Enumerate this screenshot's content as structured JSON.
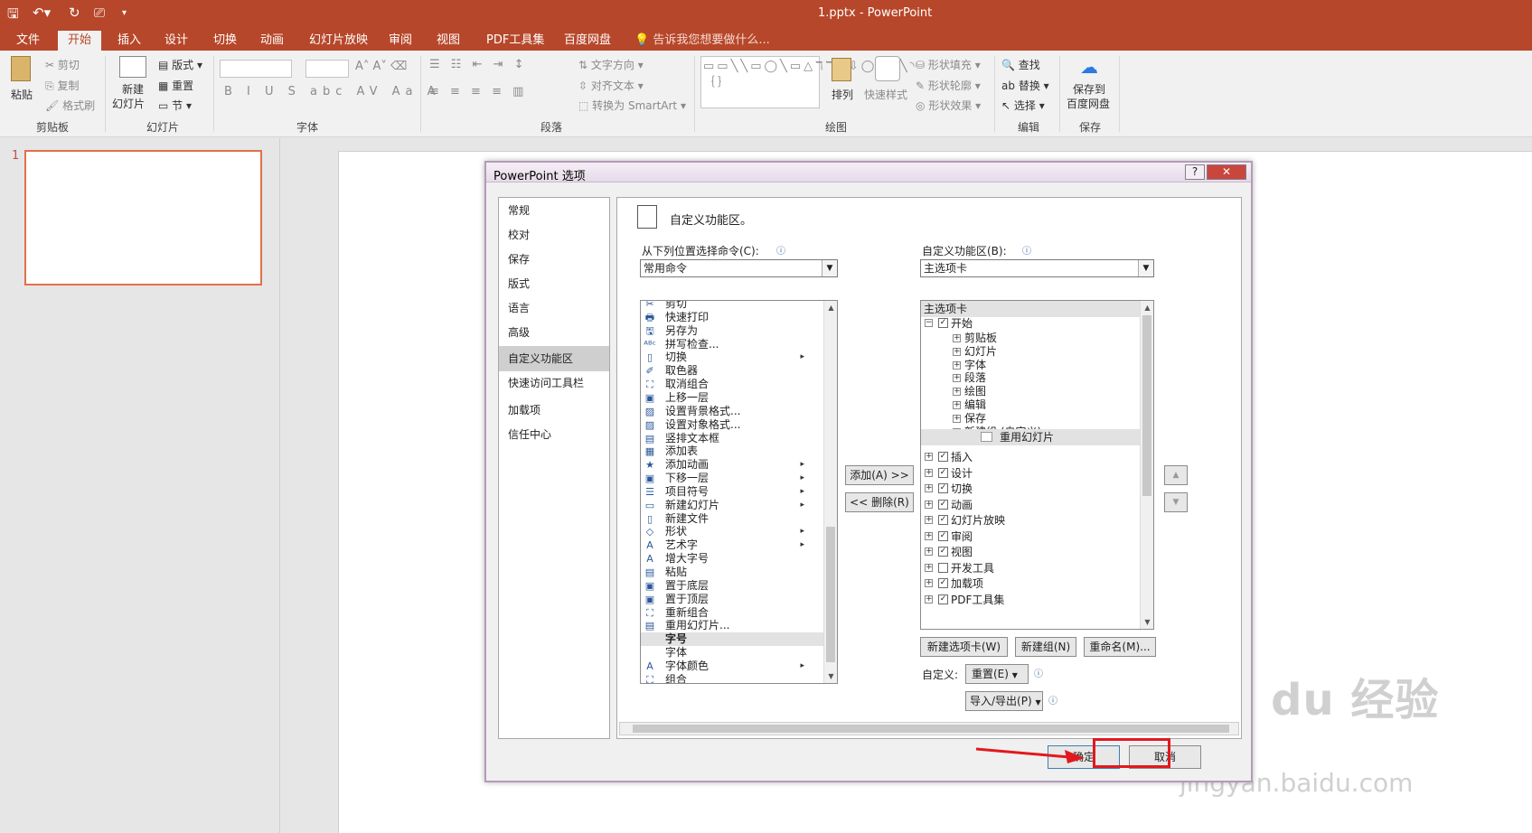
{
  "titlebar": {
    "title": "1.pptx - PowerPoint"
  },
  "tabs": [
    "文件",
    "开始",
    "插入",
    "设计",
    "切换",
    "动画",
    "幻灯片放映",
    "审阅",
    "视图",
    "PDF工具集",
    "百度网盘"
  ],
  "tell_me": "告诉我您想要做什么...",
  "ribbon": {
    "clipboard": {
      "paste": "粘贴",
      "cut": "剪切",
      "copy": "复制",
      "format_painter": "格式刷",
      "label": "剪贴板"
    },
    "slides": {
      "new_slide_1": "新建",
      "new_slide_2": "幻灯片",
      "layout": "版式",
      "reset": "重置",
      "section": "节",
      "label": "幻灯片"
    },
    "font": {
      "label": "字体"
    },
    "paragraph": {
      "text_direction": "文字方向",
      "align_text": "对齐文本",
      "smartart": "转换为 SmartArt",
      "label": "段落"
    },
    "drawing": {
      "arrange": "排列",
      "quick_styles": "快速样式",
      "shape_fill": "形状填充",
      "shape_outline": "形状轮廓",
      "shape_effects": "形状效果",
      "label": "绘图"
    },
    "editing": {
      "find": "查找",
      "replace": "替换",
      "select": "选择",
      "label": "编辑"
    },
    "save": {
      "save_1": "保存到",
      "save_2": "百度网盘",
      "label": "保存"
    }
  },
  "thumbnail": {
    "number": "1"
  },
  "dialog": {
    "title": "PowerPoint 选项",
    "help": "?",
    "close": "✕",
    "categories": [
      "常规",
      "校对",
      "保存",
      "版式",
      "语言",
      "高级",
      "自定义功能区",
      "快速访问工具栏",
      "加载项",
      "信任中心"
    ],
    "heading": "自定义功能区。",
    "left_label": "从下列位置选择命令(C):",
    "left_combo": "常用命令",
    "right_label": "自定义功能区(B):",
    "right_combo": "主选项卡",
    "commands": [
      "剪切",
      "快速打印",
      "另存为",
      "拼写检查...",
      "切换",
      "取色器",
      "取消组合",
      "上移一层",
      "设置背景格式...",
      "设置对象格式...",
      "竖排文本框",
      "添加表",
      "添加动画",
      "下移一层",
      "项目符号",
      "新建幻灯片",
      "新建文件",
      "形状",
      "艺术字",
      "增大字号",
      "粘贴",
      "置于底层",
      "置于顶层",
      "重新组合",
      "重用幻灯片...",
      "字号",
      "字体",
      "字体颜色",
      "组合"
    ],
    "add_button": "添加(A) >>",
    "remove_button": "<< 删除(R)",
    "tree": {
      "header": "主选项卡",
      "start": "开始",
      "start_groups": [
        "剪贴板",
        "幻灯片",
        "字体",
        "段落",
        "绘图",
        "编辑",
        "保存"
      ],
      "new_group": "新建组 (自定义)",
      "reuse": "重用幻灯片",
      "tabs": [
        "插入",
        "设计",
        "切换",
        "动画",
        "幻灯片放映",
        "审阅",
        "视图",
        "开发工具",
        "加载项",
        "PDF工具集"
      ]
    },
    "new_tab": "新建选项卡(W)",
    "new_group_btn": "新建组(N)",
    "rename": "重命名(M)...",
    "customize_label": "自定义:",
    "reset": "重置(E)",
    "import_export": "导入/导出(P)",
    "ok": "确定",
    "cancel": "取消"
  },
  "watermark": {
    "text": "Bai du 经验",
    "url": "jingyan.baidu.com"
  },
  "colors": {
    "accent": "#b7472a",
    "highlight": "#e1191f"
  }
}
